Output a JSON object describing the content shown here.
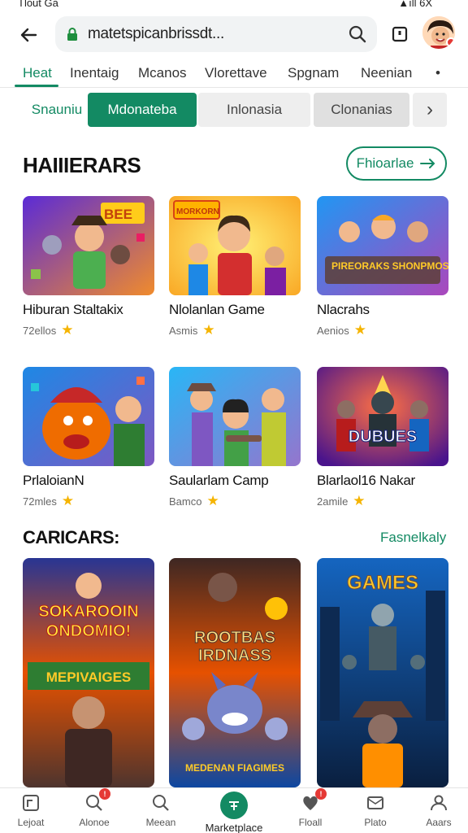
{
  "status": {
    "time": "Tlout Ga",
    "right": "▲ıll 6X"
  },
  "browser": {
    "url": "matetspicanbrissdt..."
  },
  "nav_tabs": [
    {
      "label": "Heat",
      "active": true
    },
    {
      "label": "Inentaig",
      "active": false
    },
    {
      "label": "Mcanos",
      "active": false
    },
    {
      "label": "Vlorettave",
      "active": false
    },
    {
      "label": "Spgnam",
      "active": false
    },
    {
      "label": "Neenian",
      "active": false
    },
    {
      "label": "•",
      "active": false
    }
  ],
  "chips": [
    {
      "label": "Snauniu",
      "style": "plain"
    },
    {
      "label": "Mdonateba",
      "style": "active"
    },
    {
      "label": "Inlonasia",
      "style": "grey"
    },
    {
      "label": "Clonanias",
      "style": "grey2"
    },
    {
      "label": "›",
      "style": "grey"
    }
  ],
  "section1": {
    "title": "HAIIIERARS",
    "see_all": "Fhioarlae"
  },
  "cards_row1": [
    {
      "title": "Hiburan Staltakix",
      "meta": "72ellos"
    },
    {
      "title": "Nlolanlan Game",
      "meta": "Asmis"
    },
    {
      "title": "Nlacrahs",
      "meta": "Aenios"
    }
  ],
  "cards_row2": [
    {
      "title": "PrlaloianN",
      "meta": "72mles"
    },
    {
      "title": "Saularlam Camp",
      "meta": "Bamco"
    },
    {
      "title": "Blarlaol16 Nakar",
      "meta": "2amile"
    }
  ],
  "section2": {
    "title": "CARICARS:",
    "see_all": "Fasnelkaly"
  },
  "posters": [
    {
      "text1": "SOKAROOIN",
      "text2": "ONDOMIO!",
      "text3": "MEPIVAIGES"
    },
    {
      "text1": "ROOTBAS",
      "text2": "IRDNASS",
      "text3": "MEDENAN FIAGIMES"
    },
    {
      "text1": "GAMES",
      "text2": "",
      "text3": ""
    }
  ],
  "thumb_texts": {
    "t3": "PIREORAKS SHONPMOS",
    "t6": "DUBUES",
    "t1": "BEE",
    "t2": "MORKORN"
  },
  "bottom_nav": [
    {
      "label": "Lejoat",
      "icon": "home-icon",
      "badge": ""
    },
    {
      "label": "Alonoe",
      "icon": "search-icon",
      "badge": "!"
    },
    {
      "label": "Meean",
      "icon": "search-icon",
      "badge": ""
    },
    {
      "label": "Marketplace",
      "icon": "marketplace-icon",
      "badge": ""
    },
    {
      "label": "Floall",
      "icon": "heart-icon",
      "badge": "!"
    },
    {
      "label": "Plato",
      "icon": "mail-icon",
      "badge": ""
    },
    {
      "label": "Aaars",
      "icon": "person-icon",
      "badge": ""
    }
  ],
  "colors": {
    "accent": "#138a63",
    "badge": "#e53935",
    "star": "#f5b400"
  }
}
